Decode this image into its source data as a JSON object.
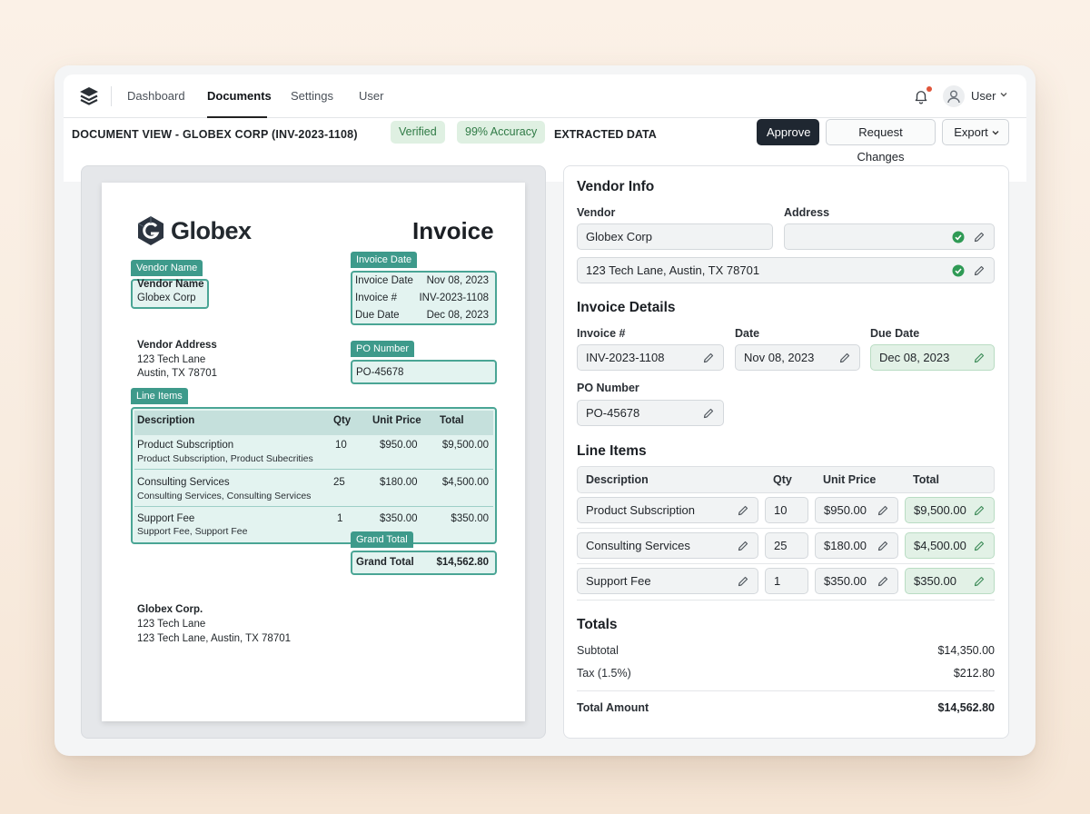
{
  "nav": {
    "items": [
      "Dashboard",
      "Documents",
      "Settings",
      "User"
    ],
    "active": "Documents",
    "user_label": "User"
  },
  "toolbar": {
    "doc_title": "DOCUMENT VIEW - GLOBEX CORP (INV-2023-1108)",
    "badge_verified": "Verified",
    "badge_accuracy": "99% Accuracy",
    "extracted_title": "EXTRACTED DATA",
    "approve_label": "Approve",
    "request_changes_label": "Request Changes",
    "export_label": "Export"
  },
  "document": {
    "brand": "Globex",
    "heading": "Invoice",
    "tags": {
      "vendor_name": "Vendor Name",
      "invoice_date": "Invoice Date",
      "po_number": "PO Number",
      "line_items": "Line Items",
      "grand_total": "Grand Total"
    },
    "vendor_name_label": "Vendor Name",
    "vendor_name_value": "Globex Corp",
    "invoice_date_label": "Invoice Date",
    "invoice_date_value": "Nov 08, 2023",
    "invoice_num_label": "Invoice #",
    "invoice_num_value": "INV-2023-1108",
    "due_date_label": "Due Date",
    "due_date_value": "Dec 08, 2023",
    "vendor_address_label": "Vendor Address",
    "vendor_address_line1": "123 Tech Lane",
    "vendor_address_line2": "Austin, TX 78701",
    "po_value": "PO-45678",
    "table_headers": [
      "Description",
      "Qty",
      "Unit Price",
      "Total"
    ],
    "lines": [
      {
        "desc": "Product Subscription",
        "sub": "Product Subscription, Product Subecrities",
        "qty": "10",
        "unit": "$950.00",
        "total": "$9,500.00"
      },
      {
        "desc": "Consulting Services",
        "sub": "Consulting Services, Consulting Services",
        "qty": "25",
        "unit": "$180.00",
        "total": "$4,500.00"
      },
      {
        "desc": "Support Fee",
        "sub": "Support Fee, Support Fee",
        "qty": "1",
        "unit": "$350.00",
        "total": "$350.00"
      }
    ],
    "grand_total_label": "Grand Total",
    "grand_total_value": "$14,562.80",
    "footer_name": "Globex Corp.",
    "footer_line1": "123 Tech Lane",
    "footer_line2": "123 Tech Lane, Austin, TX 78701"
  },
  "extracted": {
    "vendor_info_title": "Vendor Info",
    "vendor_label": "Vendor",
    "vendor_value": "Globex Corp",
    "address_label": "Address",
    "address_value": "",
    "address_line_value": "123 Tech Lane, Austin, TX 78701",
    "invoice_details_title": "Invoice Details",
    "invoice_num_label": "Invoice #",
    "invoice_num_value": "INV-2023-1108",
    "date_label": "Date",
    "date_value": "Nov 08, 2023",
    "due_date_label": "Due Date",
    "due_date_value": "Dec 08, 2023",
    "po_label": "PO Number",
    "po_value": "PO-45678",
    "line_items_title": "Line Items",
    "line_headers": [
      "Description",
      "Qty",
      "Unit Price",
      "Total"
    ],
    "lines": [
      {
        "desc": "Product Subscription",
        "qty": "10",
        "unit": "$950.00",
        "total": "$9,500.00"
      },
      {
        "desc": "Consulting Services",
        "qty": "25",
        "unit": "$180.00",
        "total": "$4,500.00"
      },
      {
        "desc": "Support Fee",
        "qty": "1",
        "unit": "$350.00",
        "total": "$350.00"
      }
    ],
    "totals_title": "Totals",
    "subtotal_label": "Subtotal",
    "subtotal_value": "$14,350.00",
    "tax_label": "Tax (1.5%)",
    "tax_value": "$212.80",
    "total_amount_label": "Total Amount",
    "total_amount_value": "$14,562.80"
  },
  "icons": {
    "logo": "stack-layers-icon",
    "bell": "bell-icon",
    "notification": "notification-dot",
    "avatar": "user-avatar-icon",
    "chevron": "chevron-down-icon",
    "pencil": "pencil-icon",
    "check": "check-circle-icon"
  },
  "colors": {
    "accent_teal": "#3e9a8b",
    "verified_green": "#2f7a45",
    "primary_button": "#1f2731",
    "confirmed_field": "#e2f1e6",
    "notification_dot": "#e0553a"
  }
}
